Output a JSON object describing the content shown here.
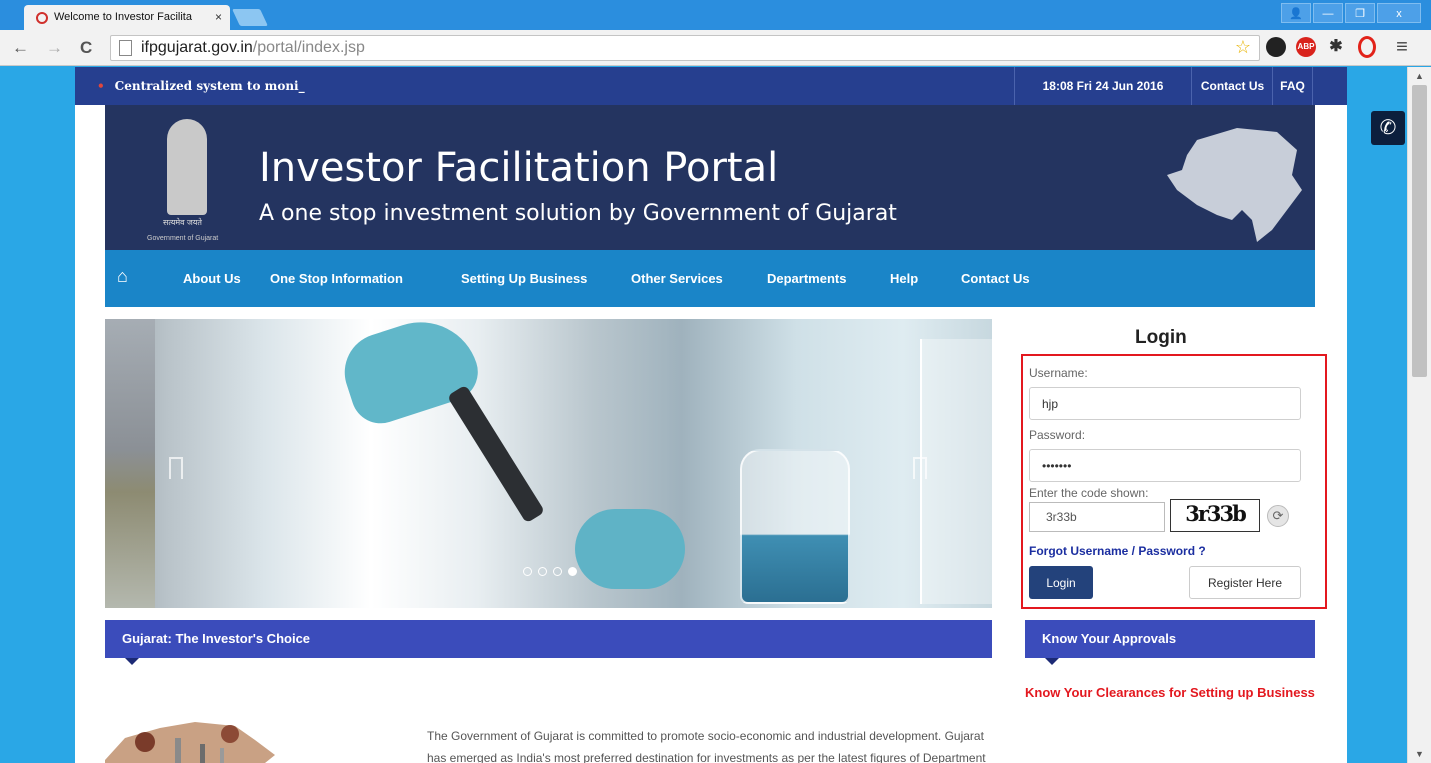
{
  "browser": {
    "tab_title": "Welcome to Investor Facilita",
    "tab_close": "×",
    "url_host": "ifpgujarat.gov.in",
    "url_path": "/portal/index.jsp",
    "window_buttons": {
      "user": "👤",
      "minimize": "—",
      "restore": "❐",
      "close": "x"
    },
    "nav": {
      "back": "←",
      "forward": "→",
      "reload": "C"
    },
    "toolbar_icons": {
      "star": "☆",
      "abp": "ABP",
      "puzzle": "✱",
      "menu": "≡"
    }
  },
  "topbar": {
    "ticker_dot": "•",
    "ticker": "Centralized system to moni_",
    "datetime": "18:08  Fri  24 Jun 2016",
    "contact_us": "Contact Us",
    "faq": "FAQ"
  },
  "header": {
    "motto": "सत्यमेव जयते",
    "emblem_caption": "Government of Gujarat",
    "title": "Investor Facilitation Portal",
    "subtitle": "A one stop investment solution by Government of Gujarat"
  },
  "nav": {
    "home_icon": "⌂",
    "items": [
      "About Us",
      "One Stop Information",
      "Setting Up Business",
      "Other Services",
      "Departments",
      "Help",
      "Contact Us"
    ]
  },
  "phone_icon": "✆",
  "login": {
    "title": "Login",
    "username_label": "Username:",
    "username_value": "hjp",
    "password_label": "Password:",
    "password_value": "•••••••",
    "captcha_label": "Enter the code shown:",
    "captcha_value": "3r33b",
    "captcha_image_text": "3r33b",
    "refresh_icon": "⟳",
    "forgot": "Forgot Username / Password ?",
    "login_button": "Login",
    "register_button": "Register Here"
  },
  "sections": {
    "investor_choice": "Gujarat: The Investor's Choice",
    "approvals": "Know Your Approvals",
    "intro_text": "The Government of Gujarat is committed to promote socio-economic and industrial development. Gujarat has emerged as India's most preferred destination for investments as per the latest figures of Department of Industrial Policy and",
    "clearances_link": "Know Your Clearances for Setting up Business"
  }
}
